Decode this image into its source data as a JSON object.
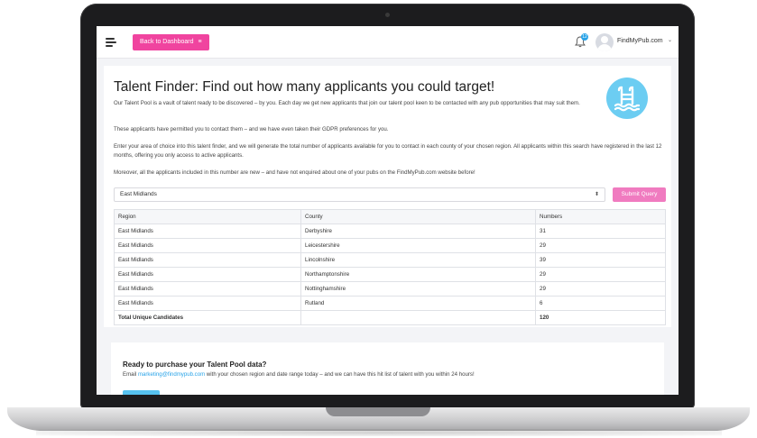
{
  "topbar": {
    "dashboard_label": "Back to Dashboard",
    "dashboard_icon": "≡",
    "notification_count": "12",
    "user_name": "FindMyPub.com",
    "user_caret": "⌄"
  },
  "main": {
    "title": "Talent Finder: Find out how many applicants you could target!",
    "paragraphs": [
      "Our Talent Pool is a vault of talent ready to be discovered – by you. Each day we get new applicants that join our talent pool keen to be contacted with any pub opportunities that may suit them.",
      "These applicants have permitted you to contact them – and we have even taken their GDPR preferences for you.",
      "Enter your area of choice into this talent finder, and we will generate the total number of applicants available for you to contact in each county of your chosen region. All applicants within this search have registered in the last 12 months, offering you only access to active applicants.",
      "Moreover, all the applicants included in this number are new – and have not enquired about one of your pubs on the FindMyPub.com website before!"
    ],
    "region_select_value": "East Midlands",
    "submit_label": "Submit Query",
    "table": {
      "headers": [
        "Region",
        "County",
        "Numbers"
      ],
      "rows": [
        [
          "East Midlands",
          "Derbyshire",
          "31"
        ],
        [
          "East Midlands",
          "Leicestershire",
          "29"
        ],
        [
          "East Midlands",
          "Lincolnshire",
          "39"
        ],
        [
          "East Midlands",
          "Northamptonshire",
          "29"
        ],
        [
          "East Midlands",
          "Nottinghamshire",
          "29"
        ],
        [
          "East Midlands",
          "Rutland",
          "6"
        ]
      ],
      "total_label": "Total Unique Candidates",
      "total_value": "120"
    }
  },
  "purchase": {
    "title": "Ready to purchase your Talent Pool data?",
    "text_before": "Email ",
    "email": "marketing@findmypub.com",
    "text_after": " with your chosen region and date range today – and we can have this hit list of talent with you within 24 hours!"
  },
  "colors": {
    "accent_pink": "#f0449f",
    "submit_pink": "#f07bc0",
    "logo_blue": "#6ccdf2",
    "link_blue": "#28a3e8"
  }
}
